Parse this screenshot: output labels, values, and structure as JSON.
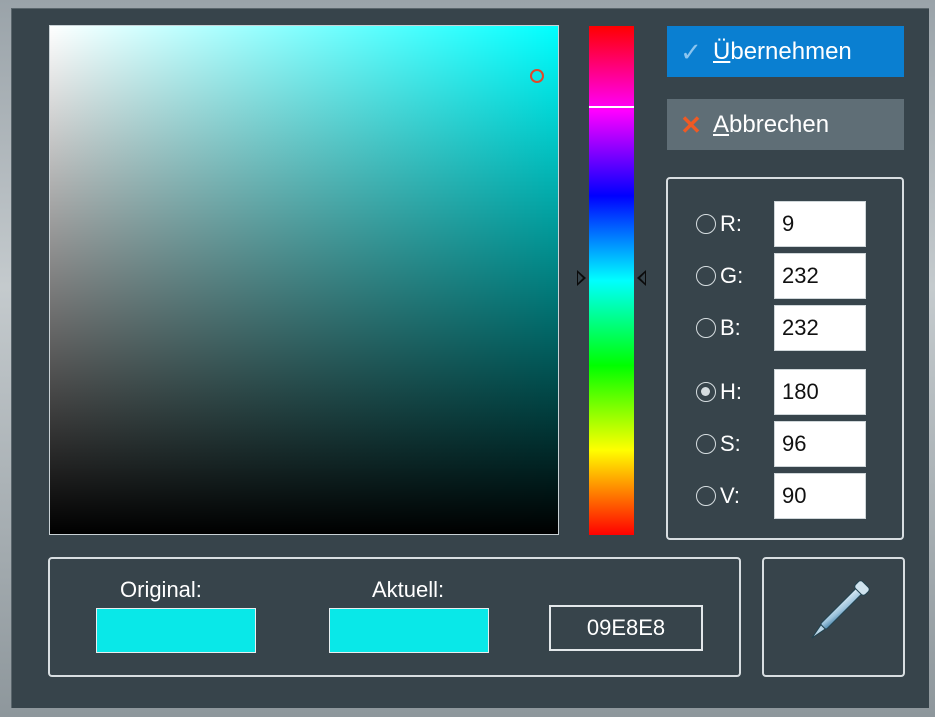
{
  "buttons": {
    "apply": {
      "icon": "checkmark-icon",
      "label_underlined": "Ü",
      "label_rest": "bernehmen"
    },
    "cancel": {
      "icon": "cross-icon",
      "label_underlined": "A",
      "label_rest": "bbrechen"
    }
  },
  "channels": [
    {
      "key": "R",
      "label": "R:",
      "value": "9",
      "selected": false
    },
    {
      "key": "G",
      "label": "G:",
      "value": "232",
      "selected": false
    },
    {
      "key": "B",
      "label": "B:",
      "value": "232",
      "selected": false
    },
    {
      "key": "H",
      "label": "H:",
      "value": "180",
      "selected": true
    },
    {
      "key": "S",
      "label": "S:",
      "value": "96",
      "selected": false
    },
    {
      "key": "V",
      "label": "V:",
      "value": "90",
      "selected": false
    }
  ],
  "swatches": {
    "original_label": "Original:",
    "current_label": "Aktuell:",
    "original_color": "#09E8E8",
    "current_color": "#09E8E8",
    "hex": "09E8E8"
  },
  "picker": {
    "icon": "eyedropper-icon"
  },
  "colors": {
    "dialog_bg": "#37444b",
    "accent": "#0a7fd1",
    "hue_color": "#00ffff",
    "cancel_icon": "#ef5a24"
  },
  "hue_slider": {
    "value_deg": 180
  }
}
